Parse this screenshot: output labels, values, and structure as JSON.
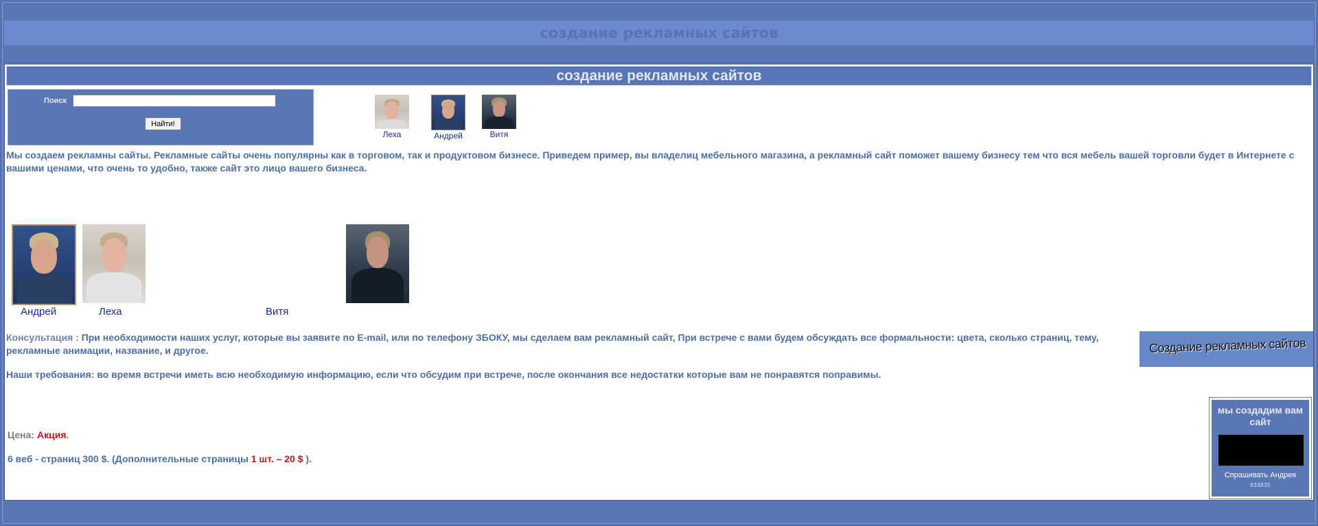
{
  "site": {
    "top_title": "создание рекламных сайтов",
    "heading": "создание рекламных сайтов"
  },
  "search": {
    "label": "Поиск",
    "input_value": "",
    "button_label": "Найти!"
  },
  "thumbnails": [
    {
      "name": "Леха"
    },
    {
      "name": "Андрей"
    },
    {
      "name": "Витя"
    }
  ],
  "intro": "Мы создаем рекламны сайты. Рекламные сайты очень популярны как в торговом, так и продуктовом бизнесе. Приведем пример, вы владелиц мебельного магазина, а рекламный сайт поможет вашему бизнесу тем что вся мебель вашей торговли будет в Интернете с вашими ценами, что очень то удобно, также сайт это лицо вашего бизнеса.",
  "photos": [
    {
      "name": "Андрей"
    },
    {
      "name": "Леха"
    },
    {
      "name": "Витя"
    }
  ],
  "consultation": {
    "lead": "Консультация :",
    "text": " При необходимости наших услуг,  которые вы заявите по E-mail, или по телефону ЗБОКУ, мы сделаем вам рекламный сайт, При встрече с вами будем обсуждать все формальности: цвета, сколько страниц, тему, рекламные анимации, название, и другое."
  },
  "requirements": "Наши требования: во время встречи иметь всю необходимую информацию, если что обсудим при встрече, после окончания все недостатки которые вам не понравятся поправимы.",
  "price": {
    "label": "Цена: ",
    "value": "Акция",
    "end": "."
  },
  "pages": {
    "text": "6 веб - страниц  300 $.   (Дополнительные страницы ",
    "extra": "1 шт. – 20 $",
    "end": " )."
  },
  "banner": {
    "text": "Создание рекламных сайтов"
  },
  "promo": {
    "title": "мы создадим вам сайт",
    "ask": "Спрашивать Андрея",
    "code": "833835"
  },
  "colors": {
    "page_bg": "#5472ad",
    "band": "#6b8ad0",
    "text_blue": "#4d6ea2",
    "accent_red": "#c0151a"
  }
}
